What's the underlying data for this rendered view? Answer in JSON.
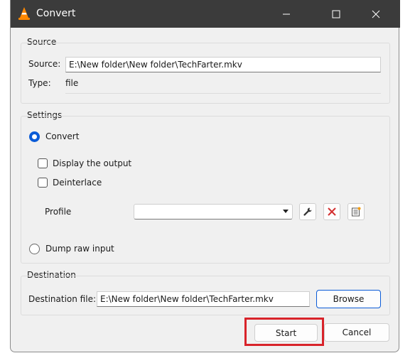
{
  "window": {
    "title": "Convert",
    "controls": {
      "minimize": "minimize-icon",
      "maximize": "maximize-icon",
      "close": "close-icon"
    }
  },
  "source": {
    "group_title": "Source",
    "source_label": "Source:",
    "source_value": "E:\\New folder\\New folder\\TechFarter.mkv",
    "type_label": "Type:",
    "type_value": "file"
  },
  "settings": {
    "group_title": "Settings",
    "convert_label": "Convert",
    "convert_selected": true,
    "display_output_label": "Display the output",
    "display_output_checked": false,
    "deinterlace_label": "Deinterlace",
    "deinterlace_checked": false,
    "profile_label": "Profile",
    "profile_value": "",
    "dump_raw_label": "Dump raw input",
    "dump_raw_selected": false
  },
  "destination": {
    "group_title": "Destination",
    "file_label": "Destination file:",
    "file_value": "E:\\New folder\\New folder\\TechFarter.mkv",
    "browse_label": "Browse"
  },
  "actions": {
    "start_label": "Start",
    "cancel_label": "Cancel"
  },
  "colors": {
    "titlebar": "#3b3b3b",
    "accent": "#0a5bd7",
    "highlight": "#d8232a",
    "delete_icon": "#d32f2f"
  }
}
